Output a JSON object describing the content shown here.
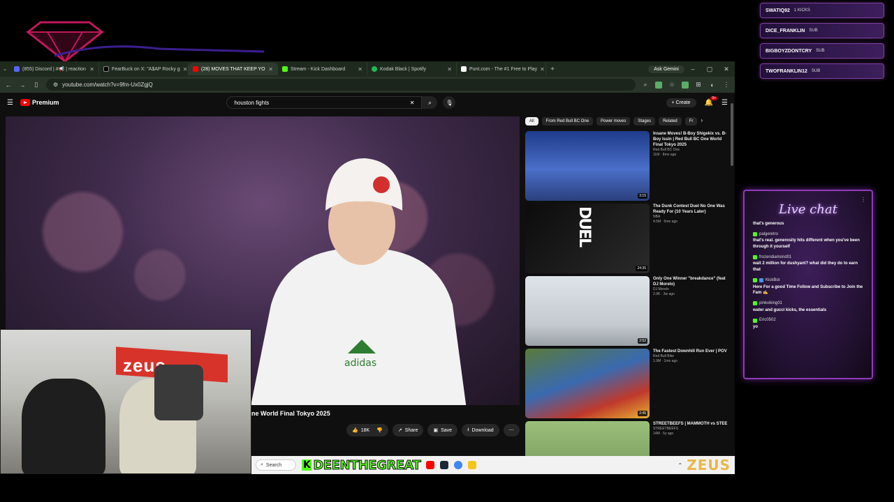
{
  "browser": {
    "tabs": [
      {
        "label": "(855) Discord | #📢 | reaction",
        "color": "#5865f2"
      },
      {
        "label": "FearBuck on X: \"A$AP Rocky g",
        "color": "#000000"
      },
      {
        "label": "(28) MOVES THAT KEEP YO",
        "color": "#ff0000",
        "active": true
      },
      {
        "label": "Stream - Kick Dashboard",
        "color": "#53fc18"
      },
      {
        "label": "Kodak Black | Spotify",
        "color": "#1db954"
      },
      {
        "label": "Punt.com - The #1 Free to Play",
        "color": "#ffffff"
      }
    ],
    "gemini_label": "Ask Gemini",
    "url": "youtube.com/watch?v=9fm-Ux0ZgjQ"
  },
  "youtube": {
    "logo_label": "Premium",
    "search_value": "houston fights",
    "create_label": "Create",
    "notif_count": "9+",
    "video_title_partial": "ne World Final Tokyo 2025",
    "likes": "18K",
    "share_label": "Share",
    "save_label": "Save",
    "download_label": "Download",
    "chips": [
      "All",
      "From Red Bull BC One",
      "Power moves",
      "Stages",
      "Related",
      "Fr"
    ],
    "recommended": [
      {
        "title": "Insane Moves! B-Boy Shigekix vs. B-Boy Issin | Red Bull BC One World Final Tokyo 2025",
        "channel": "Red Bull BC One",
        "stats": "11M · 8mo ago",
        "duration": "3:15"
      },
      {
        "title": "The Dunk Contest Duel No One Was Ready For (10 Years Later)",
        "channel": "NBA",
        "stats": "4.5M · 5mo ago",
        "duration": "24:35"
      },
      {
        "title": "Only One Winner \"breakdance\" (feat DJ Morelo)",
        "channel": "DJ Morelo",
        "stats": "2.9K · 3w ago",
        "duration": "2:52"
      },
      {
        "title": "The Fastest Downhill Run Ever | POV",
        "channel": "Red Bull Bike",
        "stats": "1.9M · 1mo ago",
        "duration": "2:45"
      },
      {
        "title": "STREETBEEFS | MAMMOTH vs STEE",
        "channel": "STREETBEEFS",
        "stats": "14M · 5y ago",
        "duration": ""
      }
    ],
    "thumb2_text": "DUEL"
  },
  "webcam": {
    "banner_text": "zeus"
  },
  "taskbar": {
    "search_placeholder": "Search",
    "kick_name": "DEENTHEGREAT",
    "brand": "ZEUS"
  },
  "events": [
    {
      "name": "SWATIQ92",
      "type": "1 KICKS"
    },
    {
      "name": "DICE_FRANKLIN",
      "type": "SUB"
    },
    {
      "name": "BIGBOYZDONTCRY",
      "type": "SUB"
    },
    {
      "name": "TWOFRANKLIN12",
      "type": "SUB"
    }
  ],
  "chat": {
    "title": "Live chat",
    "messages": [
      {
        "user": "",
        "text": "that's generous"
      },
      {
        "user": "palgeretro",
        "text": "that's real. generosity hits different when you've been through it yourself"
      },
      {
        "user": "frozendiamond01",
        "text": "wait 2 million for dushyant? what did they do to earn that"
      },
      {
        "user": "KickBot",
        "text": "Here For a good Time Follow and Subscribe to Join the Fam ✍"
      },
      {
        "user": "pinkviking01",
        "text": "water and gucci kicks, the essentials"
      },
      {
        "user": "Eric0502",
        "text": "yo"
      }
    ]
  },
  "colors": {
    "accent_purple": "#8f3bb8",
    "kick_green": "#53fc18",
    "yt_red": "#ff0000"
  }
}
